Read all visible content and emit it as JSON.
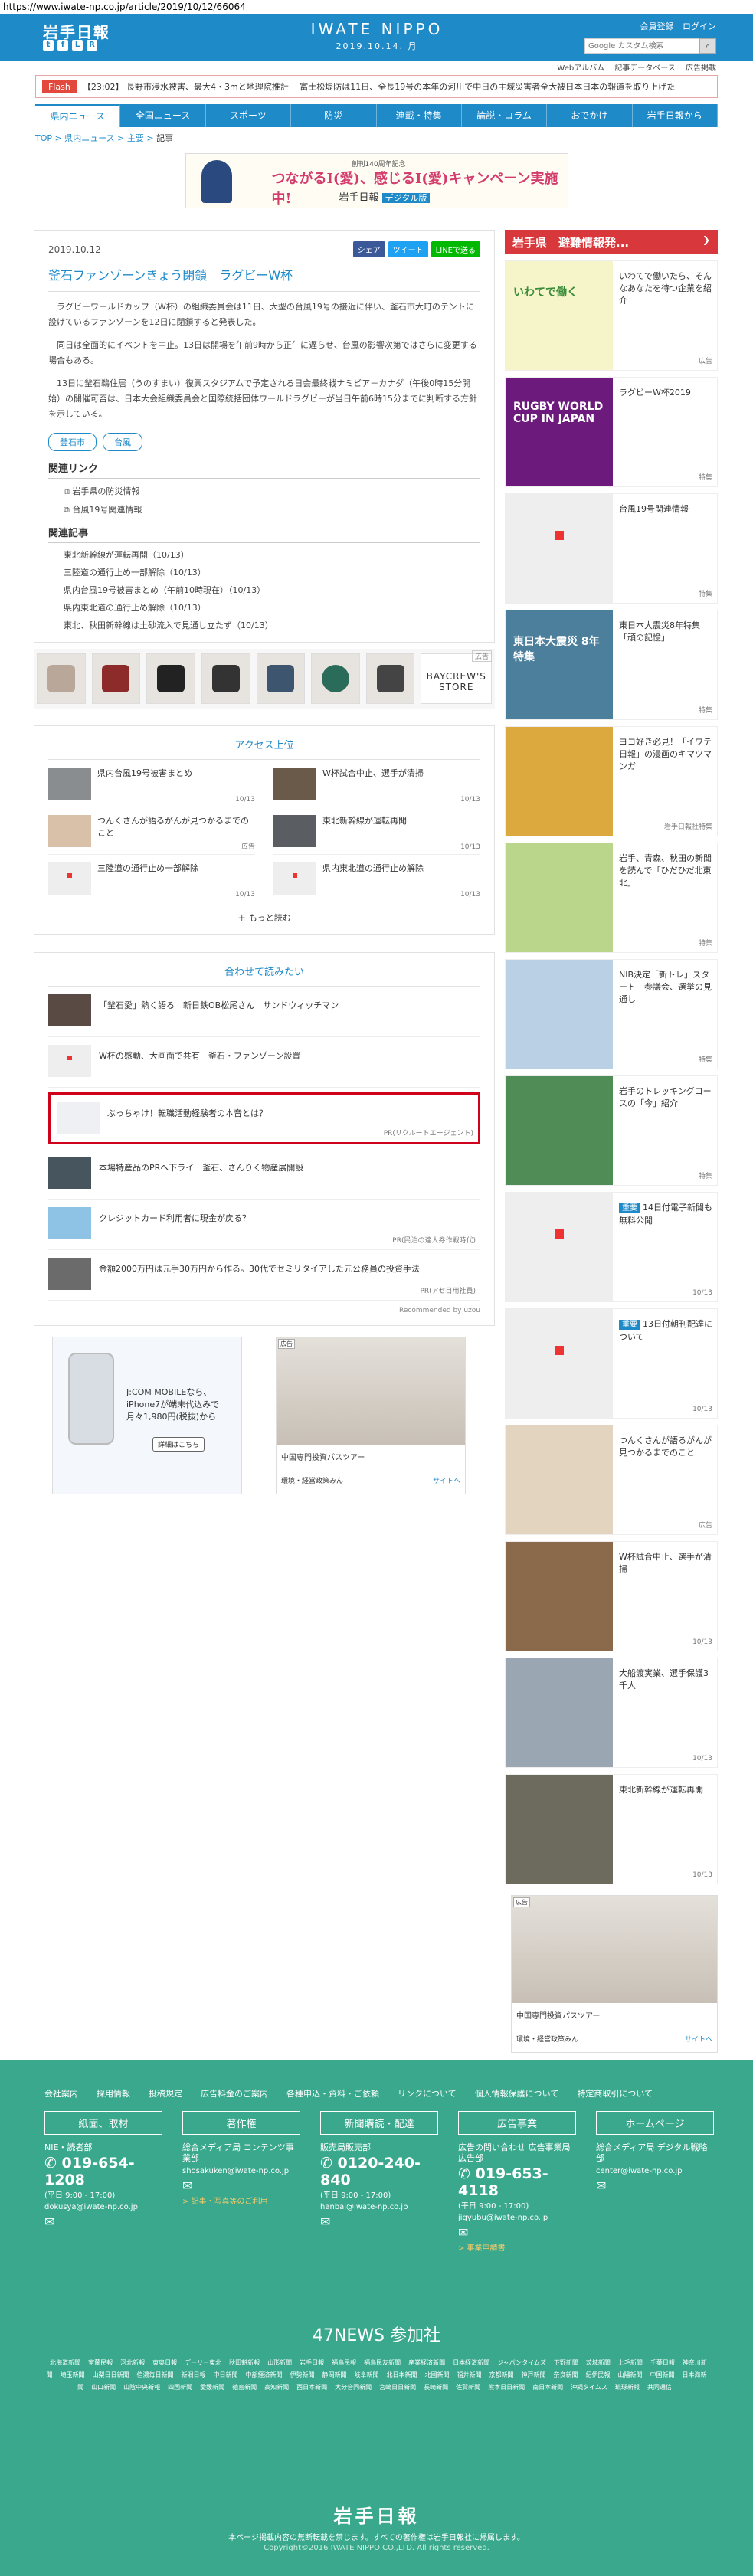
{
  "url": "https://www.iwate-np.co.jp/article/2019/10/12/66064",
  "header": {
    "logo": "岩手日報",
    "brand": "IWATE NIPPO",
    "date": "2019.10.14. 月",
    "links": [
      "会員登録",
      "ログイン"
    ],
    "search_placeholder": "Google カスタム検索",
    "subnav": [
      "Webアルバム",
      "記事データベース",
      "広告掲載"
    ]
  },
  "flash": {
    "tag": "Flash",
    "text": "【23:02】 長野市浸水被害、最大4・3mと地理院推計 　富士松堤防は11日、全長19号の本年の河川で中日の主域災害者全大被日本日本の報道を取り上げた"
  },
  "nav": [
    "県内ニュース",
    "全国ニュース",
    "スポーツ",
    "防災",
    "連載・特集",
    "論説・コラム",
    "おでかけ",
    "岩手日報から"
  ],
  "breadcrumb": [
    "TOP",
    "県内ニュース",
    "主要",
    "記事"
  ],
  "banner": {
    "small": "創刊140周年記念",
    "main": "つながるI(愛)、感じるI(愛)キャンペーン実施中!",
    "sub": "岩手日報",
    "badge": "デジタル版"
  },
  "article": {
    "date": "2019.10.12",
    "share": [
      "シェア",
      "ツイート",
      "LINEで送る"
    ],
    "title": "釜石ファンゾーンきょう閉鎖　ラグビーW杯",
    "body": [
      "ラグビーワールドカップ（W杯）の組織委員会は11日、大型の台風19号の接近に伴い、釜石市大町のテントに設けているファンゾーンを12日に閉鎖すると発表した。",
      "同日は全面的にイベントを中止。13日は開場を午前9時から正午に遅らせ、台風の影響次第ではさらに変更する場合もある。",
      "13日に釜石鵜住居（うのすまい）復興スタジアムで予定される日会最終戦ナミビア－カナダ（午後0時15分開始）の開催可否は、日本大会組織委員会と国際統括団体ワールドラグビーが当日午前6時15分までに判断する方針を示している。"
    ],
    "tags": [
      "釜石市",
      "台風"
    ],
    "links_heading": "関連リンク",
    "links": [
      "岩手県の防災情報",
      "台風19号関連情報"
    ],
    "related_heading": "関連記事",
    "related": [
      "東北新幹線が運転再開（10/13）",
      "三陸道の通行止め一部解除（10/13）",
      "県内台風19号被害まとめ（午前10時現在）（10/13）",
      "県内東北道の通行止め解除（10/13）",
      "東北、秋田新幹線は土砂流入で見通し立たず（10/13）"
    ]
  },
  "strip": {
    "brand": "BAYCREW'S STORE",
    "ad": "広告"
  },
  "access": {
    "heading": "アクセス上位",
    "items": [
      {
        "title": "県内台風19号被害まとめ",
        "date": "10/13"
      },
      {
        "title": "W杯試合中止、選手が清掃",
        "date": "10/13"
      },
      {
        "title": "つんくさんが語るがんが見つかるまでのこと",
        "date": "広告"
      },
      {
        "title": "東北新幹線が運転再開",
        "date": "10/13"
      },
      {
        "title": "三陸道の通行止め一部解除",
        "date": "10/13"
      },
      {
        "title": "県内東北道の通行止め解除",
        "date": "10/13"
      }
    ],
    "more": "もっと読む"
  },
  "read": {
    "heading": "合わせて読みたい",
    "items": [
      {
        "title": "「釜石愛」熱く語る　新日鉄OB松尾さん　サンドウィッチマン",
        "pr": ""
      },
      {
        "title": "W杯の感動、大画面で共有　釜石・ファンゾーン設置",
        "pr": ""
      },
      {
        "title": "ぶっちゃけ！転職活動経験者の本音とは？",
        "pr": "PR(リクルートエージェント)"
      },
      {
        "title": "本場特産品のPRへ下ライ　釜石、さんりく物産展開設",
        "pr": ""
      },
      {
        "title": "クレジットカード利用者に現金が戻る？",
        "pr": "PR(民泊の達人券作戦時代)"
      },
      {
        "title": "金額2000万円は元手30万円から作る。30代でセミリタイアした元公務員の投資手法",
        "pr": "PR(アセ目用社員)"
      }
    ],
    "recommended_by": "Recommended by uzou"
  },
  "ads": {
    "jcom": {
      "line1": "J:COM MOBILEなら、",
      "line2": "iPhone7が端末代込みで",
      "line3": "月々1,980円(税抜)から",
      "button": "詳細はこちら"
    },
    "inv": {
      "label": "広告",
      "title": "中国専門投資パスツアー",
      "sub": "環境・経営政策みん",
      "site": "サイトへ"
    }
  },
  "sidebar": {
    "evac": "岩手県　避難情報発...",
    "items": [
      {
        "title": "いわてで働いたら、そんなあなたを待つ企業を紹介",
        "label": "広告",
        "color": "#f6f4c9",
        "img_text": "いわてで働く"
      },
      {
        "title": "ラグビーW杯2019",
        "label": "特集",
        "color": "#6c1b7c",
        "img_text": "RUGBY WORLD CUP IN JAPAN"
      },
      {
        "title": "台風19号関連情報",
        "label": "特集",
        "color": "",
        "img_text": ""
      },
      {
        "title": "東日本大震災8年特集「頑の記憶」",
        "label": "特集",
        "color": "#4c7f9c",
        "img_text": "東日本大震災 8年特集"
      },
      {
        "title": "ヨコ好き必見！「イワテ日報」の漫画のキマツマンガ",
        "label": "岩手日報社特集",
        "color": "#dca93e",
        "img_text": ""
      },
      {
        "title": "岩手、青森、秋田の新聞を読んで「ひだひだ北東北」",
        "label": "特集",
        "color": "#bad68a",
        "img_text": ""
      },
      {
        "title": "NIB決定「新トレ」スタート　参議会、選挙の見通し",
        "label": "特集",
        "color": "#bad0e4",
        "img_text": ""
      },
      {
        "title": "岩手のトレッキングコースの「今」紹介",
        "label": "特集",
        "color": "#4f8c56",
        "img_text": ""
      },
      {
        "title": "14日付電子新聞も無料公開",
        "badge": "重要",
        "label": "10/13",
        "color": "",
        "img_text": ""
      },
      {
        "title": "13日付朝刊配達について",
        "badge": "重要",
        "label": "10/13",
        "color": "",
        "img_text": ""
      },
      {
        "title": "つんくさんが語るがんが見つかるまでのこと",
        "label": "広告",
        "color": "#e3d4c0",
        "img_text": ""
      },
      {
        "title": "W杯試合中止、選手が清掃",
        "label": "10/13",
        "color": "#8a6a4a",
        "img_text": ""
      },
      {
        "title": "大船渡実業、選手保護3千人",
        "label": "10/13",
        "color": "#9aa7b2",
        "img_text": ""
      },
      {
        "title": "東北新幹線が運転再開",
        "label": "10/13",
        "color": "#6d6a5e",
        "img_text": ""
      }
    ]
  },
  "footer": {
    "links": [
      "会社案内",
      "採用情報",
      "投稿規定",
      "広告料金のご案内",
      "各種申込・資料・ご依頼",
      "リンクについて",
      "個人情報保護について",
      "特定商取引について"
    ],
    "contacts": [
      {
        "h": "紙面、取材",
        "l": "NIE・読者部",
        "tel": "019-654-1208",
        "sm": "(平日 9:00 - 17:00)",
        "mail": "dokusya@iwate-np.co.jp",
        "or": ""
      },
      {
        "h": "著作権",
        "l": "総合メディア局 コンテンツ事業部",
        "tel": "",
        "sm": "",
        "mail": "shosakuken@iwate-np.co.jp",
        "or": "> 記事・写真等のご利用"
      },
      {
        "h": "新聞購読・配達",
        "l": "販売局販売部",
        "tel": "0120-240-840",
        "sm": "(平日 9:00 - 17:00)",
        "mail": "hanbai@iwate-np.co.jp",
        "or": ""
      },
      {
        "h": "広告事業",
        "l": "広告の問い合わせ 広告事業局広告部",
        "tel": "019-653-4118",
        "sm": "(平日 9:00 - 17:00)",
        "mail": "jigyubu@iwate-np.co.jp",
        "or": "> 事業申請書"
      },
      {
        "h": "ホームページ",
        "l": "総合メディア局 デジタル戦略部",
        "tel": "",
        "sm": "",
        "mail": "center@iwate-np.co.jp",
        "or": ""
      }
    ],
    "news47": "47NEWS 参加社",
    "news47_list": [
      "北海道新聞",
      "室蘭民報",
      "河北新報",
      "東奥日報",
      "デーリー東北",
      "秋田魁新報",
      "山形新聞",
      "岩手日報",
      "福島民報",
      "福島民友新聞",
      "産業経済新聞",
      "日本経済新聞",
      "ジャパンタイムズ",
      "下野新聞",
      "茨城新聞",
      "上毛新聞",
      "千葉日報",
      "神奈川新聞",
      "埼玉新聞",
      "山梨日日新聞",
      "信濃毎日新聞",
      "新潟日報",
      "中日新聞",
      "中部経済新聞",
      "伊勢新聞",
      "静岡新聞",
      "岐阜新聞",
      "北日本新聞",
      "北國新聞",
      "福井新聞",
      "京都新聞",
      "神戸新聞",
      "奈良新聞",
      "紀伊民報",
      "山陽新聞",
      "中国新聞",
      "日本海新聞",
      "山口新聞",
      "山陰中央新報",
      "四国新聞",
      "愛媛新聞",
      "徳島新聞",
      "高知新聞",
      "西日本新聞",
      "大分合同新聞",
      "宮崎日日新聞",
      "長崎新聞",
      "佐賀新聞",
      "熊本日日新聞",
      "南日本新聞",
      "沖縄タイムス",
      "琉球新報",
      "共同通信"
    ],
    "logo": "岩手日報",
    "note": "本ページ掲載内容の無断転載を禁じます。すべての著作権は岩手日報社に帰属します。",
    "copy": "Copyright©2016 IWATE NIPPO CO.,LTD. All rights reserved."
  }
}
